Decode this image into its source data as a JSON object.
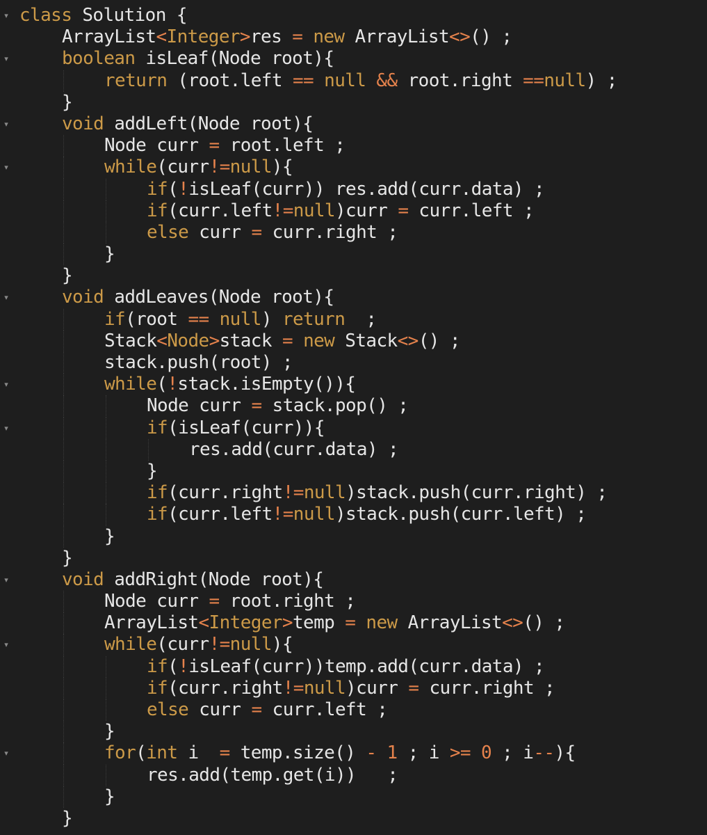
{
  "colors": {
    "background": "#1e1e1e",
    "text": "#e6e6e6",
    "keyword": "#cc9a48",
    "operator": "#e5824c",
    "fold_marker": "#8a8a8a"
  },
  "editor": {
    "fold_icon": "chevron-down-icon",
    "lines": [
      {
        "indent": 0,
        "fold": true,
        "tokens": [
          [
            "kw",
            "class"
          ],
          [
            "id",
            " Solution {"
          ]
        ]
      },
      {
        "indent": 1,
        "fold": false,
        "tokens": [
          [
            "id",
            "ArrayList"
          ],
          [
            "op",
            "<"
          ],
          [
            "kw",
            "Integer"
          ],
          [
            "op",
            ">"
          ],
          [
            "id",
            "res "
          ],
          [
            "op",
            "="
          ],
          [
            "id",
            " "
          ],
          [
            "kw",
            "new"
          ],
          [
            "id",
            " ArrayList"
          ],
          [
            "op",
            "<>"
          ],
          [
            "id",
            "() ;"
          ]
        ]
      },
      {
        "indent": 1,
        "fold": true,
        "tokens": [
          [
            "kw",
            "boolean"
          ],
          [
            "id",
            " isLeaf(Node root){"
          ]
        ]
      },
      {
        "indent": 2,
        "fold": false,
        "tokens": [
          [
            "kw",
            "return"
          ],
          [
            "id",
            " (root.left "
          ],
          [
            "op",
            "=="
          ],
          [
            "id",
            " "
          ],
          [
            "kw",
            "null"
          ],
          [
            "id",
            " "
          ],
          [
            "op",
            "&&"
          ],
          [
            "id",
            " root.right "
          ],
          [
            "op",
            "=="
          ],
          [
            "kw",
            "null"
          ],
          [
            "id",
            ") ;"
          ]
        ]
      },
      {
        "indent": 1,
        "fold": false,
        "tokens": [
          [
            "id",
            "}"
          ]
        ]
      },
      {
        "indent": 1,
        "fold": true,
        "tokens": [
          [
            "kw",
            "void"
          ],
          [
            "id",
            " addLeft(Node root){"
          ]
        ]
      },
      {
        "indent": 2,
        "fold": false,
        "tokens": [
          [
            "id",
            "Node curr "
          ],
          [
            "op",
            "="
          ],
          [
            "id",
            " root.left ;"
          ]
        ]
      },
      {
        "indent": 2,
        "fold": true,
        "tokens": [
          [
            "kw",
            "while"
          ],
          [
            "id",
            "(curr"
          ],
          [
            "op",
            "!="
          ],
          [
            "kw",
            "null"
          ],
          [
            "id",
            "){"
          ]
        ]
      },
      {
        "indent": 3,
        "fold": false,
        "tokens": [
          [
            "kw",
            "if"
          ],
          [
            "id",
            "("
          ],
          [
            "op",
            "!"
          ],
          [
            "id",
            "isLeaf(curr)) res.add(curr.data) ;"
          ]
        ]
      },
      {
        "indent": 3,
        "fold": false,
        "tokens": [
          [
            "kw",
            "if"
          ],
          [
            "id",
            "(curr.left"
          ],
          [
            "op",
            "!="
          ],
          [
            "kw",
            "null"
          ],
          [
            "id",
            ")curr "
          ],
          [
            "op",
            "="
          ],
          [
            "id",
            " curr.left ;"
          ]
        ]
      },
      {
        "indent": 3,
        "fold": false,
        "tokens": [
          [
            "kw",
            "else"
          ],
          [
            "id",
            " curr "
          ],
          [
            "op",
            "="
          ],
          [
            "id",
            " curr.right ;"
          ]
        ]
      },
      {
        "indent": 2,
        "fold": false,
        "tokens": [
          [
            "id",
            "}"
          ]
        ]
      },
      {
        "indent": 1,
        "fold": false,
        "tokens": [
          [
            "id",
            "}"
          ]
        ]
      },
      {
        "indent": 1,
        "fold": true,
        "tokens": [
          [
            "kw",
            "void"
          ],
          [
            "id",
            " addLeaves(Node root){"
          ]
        ]
      },
      {
        "indent": 2,
        "fold": false,
        "tokens": [
          [
            "kw",
            "if"
          ],
          [
            "id",
            "(root "
          ],
          [
            "op",
            "=="
          ],
          [
            "id",
            " "
          ],
          [
            "kw",
            "null"
          ],
          [
            "id",
            ") "
          ],
          [
            "kw",
            "return"
          ],
          [
            "id",
            "  ;"
          ]
        ]
      },
      {
        "indent": 2,
        "fold": false,
        "tokens": [
          [
            "id",
            "Stack"
          ],
          [
            "op",
            "<"
          ],
          [
            "kw",
            "Node"
          ],
          [
            "op",
            ">"
          ],
          [
            "id",
            "stack "
          ],
          [
            "op",
            "="
          ],
          [
            "id",
            " "
          ],
          [
            "kw",
            "new"
          ],
          [
            "id",
            " Stack"
          ],
          [
            "op",
            "<>"
          ],
          [
            "id",
            "() ;"
          ]
        ]
      },
      {
        "indent": 2,
        "fold": false,
        "tokens": [
          [
            "id",
            "stack.push(root) ;"
          ]
        ]
      },
      {
        "indent": 2,
        "fold": true,
        "tokens": [
          [
            "kw",
            "while"
          ],
          [
            "id",
            "("
          ],
          [
            "op",
            "!"
          ],
          [
            "id",
            "stack.isEmpty()){"
          ]
        ]
      },
      {
        "indent": 3,
        "fold": false,
        "tokens": [
          [
            "id",
            "Node curr "
          ],
          [
            "op",
            "="
          ],
          [
            "id",
            " stack.pop() ;"
          ]
        ]
      },
      {
        "indent": 3,
        "fold": true,
        "tokens": [
          [
            "kw",
            "if"
          ],
          [
            "id",
            "(isLeaf(curr)){"
          ]
        ]
      },
      {
        "indent": 4,
        "fold": false,
        "tokens": [
          [
            "id",
            "res.add(curr.data) ;"
          ]
        ]
      },
      {
        "indent": 3,
        "fold": false,
        "tokens": [
          [
            "id",
            "}"
          ]
        ]
      },
      {
        "indent": 3,
        "fold": false,
        "tokens": [
          [
            "kw",
            "if"
          ],
          [
            "id",
            "(curr.right"
          ],
          [
            "op",
            "!="
          ],
          [
            "kw",
            "null"
          ],
          [
            "id",
            ")stack.push(curr.right) ;"
          ]
        ]
      },
      {
        "indent": 3,
        "fold": false,
        "tokens": [
          [
            "kw",
            "if"
          ],
          [
            "id",
            "(curr.left"
          ],
          [
            "op",
            "!="
          ],
          [
            "kw",
            "null"
          ],
          [
            "id",
            ")stack.push(curr.left) ;"
          ]
        ]
      },
      {
        "indent": 2,
        "fold": false,
        "tokens": [
          [
            "id",
            "}"
          ]
        ]
      },
      {
        "indent": 1,
        "fold": false,
        "tokens": [
          [
            "id",
            "}"
          ]
        ]
      },
      {
        "indent": 1,
        "fold": true,
        "tokens": [
          [
            "kw",
            "void"
          ],
          [
            "id",
            " addRight(Node root){"
          ]
        ]
      },
      {
        "indent": 2,
        "fold": false,
        "tokens": [
          [
            "id",
            "Node curr "
          ],
          [
            "op",
            "="
          ],
          [
            "id",
            " root.right ;"
          ]
        ]
      },
      {
        "indent": 2,
        "fold": false,
        "tokens": [
          [
            "id",
            "ArrayList"
          ],
          [
            "op",
            "<"
          ],
          [
            "kw",
            "Integer"
          ],
          [
            "op",
            ">"
          ],
          [
            "id",
            "temp "
          ],
          [
            "op",
            "="
          ],
          [
            "id",
            " "
          ],
          [
            "kw",
            "new"
          ],
          [
            "id",
            " ArrayList"
          ],
          [
            "op",
            "<>"
          ],
          [
            "id",
            "() ;"
          ]
        ]
      },
      {
        "indent": 2,
        "fold": true,
        "tokens": [
          [
            "kw",
            "while"
          ],
          [
            "id",
            "(curr"
          ],
          [
            "op",
            "!="
          ],
          [
            "kw",
            "null"
          ],
          [
            "id",
            "){"
          ]
        ]
      },
      {
        "indent": 3,
        "fold": false,
        "tokens": [
          [
            "kw",
            "if"
          ],
          [
            "id",
            "("
          ],
          [
            "op",
            "!"
          ],
          [
            "id",
            "isLeaf(curr))temp.add(curr.data) ;"
          ]
        ]
      },
      {
        "indent": 3,
        "fold": false,
        "tokens": [
          [
            "kw",
            "if"
          ],
          [
            "id",
            "(curr.right"
          ],
          [
            "op",
            "!="
          ],
          [
            "kw",
            "null"
          ],
          [
            "id",
            ")curr "
          ],
          [
            "op",
            "="
          ],
          [
            "id",
            " curr.right ;"
          ]
        ]
      },
      {
        "indent": 3,
        "fold": false,
        "tokens": [
          [
            "kw",
            "else"
          ],
          [
            "id",
            " curr "
          ],
          [
            "op",
            "="
          ],
          [
            "id",
            " curr.left ;"
          ]
        ]
      },
      {
        "indent": 2,
        "fold": false,
        "tokens": [
          [
            "id",
            "}"
          ]
        ]
      },
      {
        "indent": 2,
        "fold": true,
        "tokens": [
          [
            "kw",
            "for"
          ],
          [
            "id",
            "("
          ],
          [
            "kw",
            "int"
          ],
          [
            "id",
            " i  "
          ],
          [
            "op",
            "="
          ],
          [
            "id",
            " temp.size() "
          ],
          [
            "op",
            "-"
          ],
          [
            "id",
            " "
          ],
          [
            "num",
            "1"
          ],
          [
            "id",
            " ; i "
          ],
          [
            "op",
            ">="
          ],
          [
            "id",
            " "
          ],
          [
            "num",
            "0"
          ],
          [
            "id",
            " ; i"
          ],
          [
            "op",
            "--"
          ],
          [
            "id",
            "){"
          ]
        ]
      },
      {
        "indent": 3,
        "fold": false,
        "tokens": [
          [
            "id",
            "res.add(temp.get(i))   ;"
          ]
        ]
      },
      {
        "indent": 2,
        "fold": false,
        "tokens": [
          [
            "id",
            "}"
          ]
        ]
      },
      {
        "indent": 1,
        "fold": false,
        "tokens": [
          [
            "id",
            "}"
          ]
        ]
      }
    ]
  }
}
